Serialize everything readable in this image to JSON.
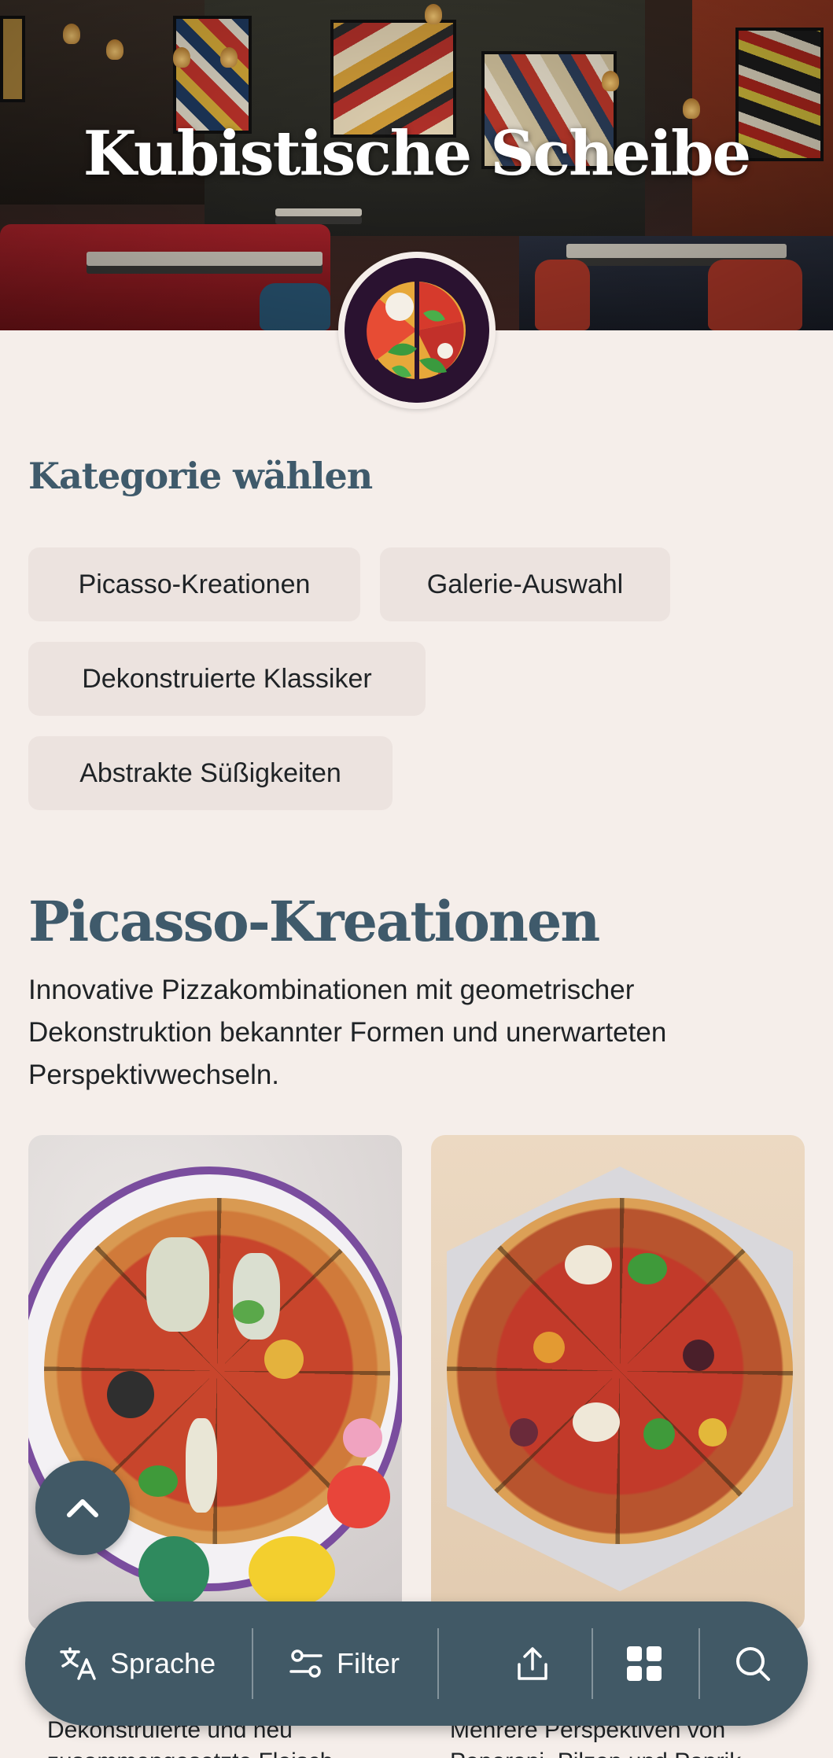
{
  "hero": {
    "title": "Kubistische Scheibe"
  },
  "categories": {
    "heading": "Kategorie wählen",
    "items": [
      {
        "label": "Picasso-Kreationen"
      },
      {
        "label": "Galerie-Auswahl"
      },
      {
        "label": "Dekonstruierte Klassiker"
      },
      {
        "label": "Abstrakte Süßigkeiten"
      }
    ]
  },
  "section": {
    "title": "Picasso-Kreationen",
    "description": "Innovative Pizzakombinationen mit geometrischer Dekonstruktion bekannter Formen und unerwarteten Perspektivwechseln.",
    "cards": [
      {
        "text": "Dekonstruierte und neu zusammengesetzte Fleisch-"
      },
      {
        "text": "Mehrere Perspektiven von Peperoni, Pilzen und Paprik"
      }
    ]
  },
  "bottom_bar": {
    "language": "Sprache",
    "filter": "Filter"
  },
  "colors": {
    "accent": "#415966",
    "heading": "#3f5a6b",
    "chip_bg": "#ece3df",
    "background": "#f5eeea"
  },
  "icons": [
    "translate-icon",
    "filter-icon",
    "share-icon",
    "grid-icon",
    "search-icon",
    "chevron-up-icon"
  ]
}
